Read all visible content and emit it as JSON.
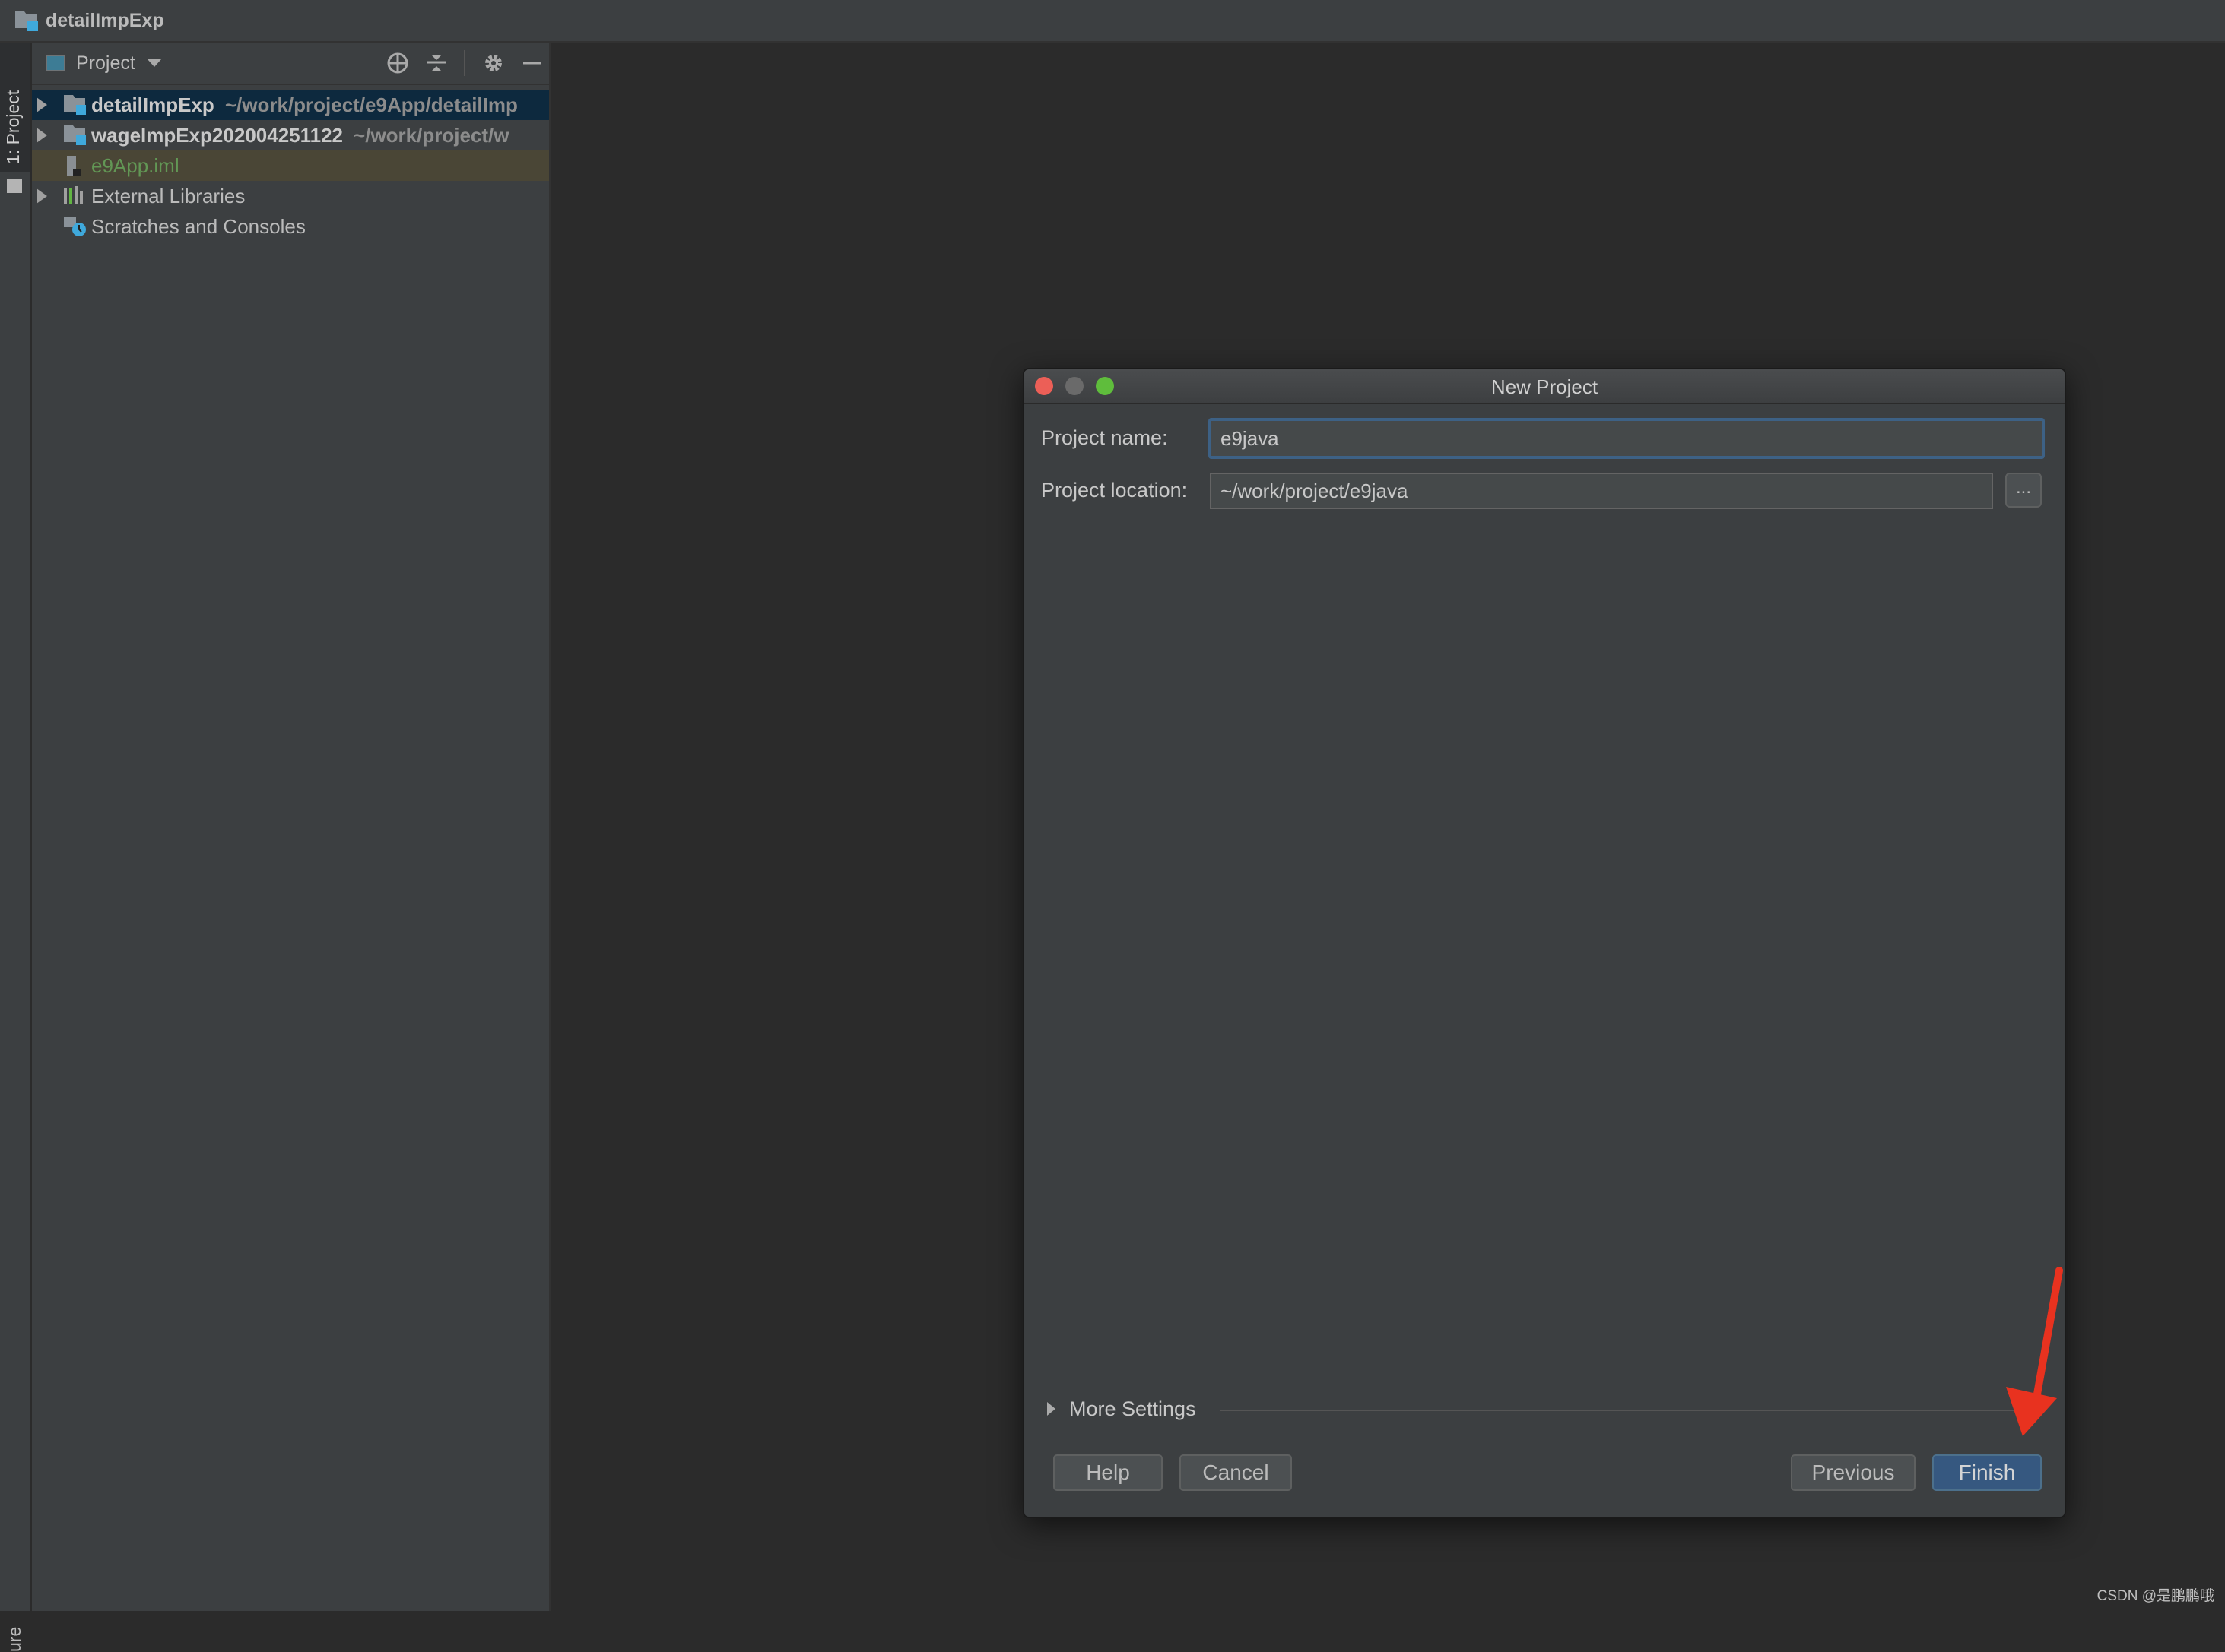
{
  "window": {
    "title": "detailImpExp"
  },
  "left_stripe": {
    "project_tab": "1: Project",
    "bottom_tab_partial": "ure"
  },
  "project_panel": {
    "view_selector": "Project",
    "tools": [
      "locate-icon",
      "collapse-all-icon",
      "settings-icon",
      "hide-icon"
    ],
    "tree": [
      {
        "name": "detailImpExp",
        "path": "~/work/project/e9App/detailImp",
        "type": "module-folder",
        "expandable": true,
        "selected": true
      },
      {
        "name": "wageImpExp202004251122",
        "path": "~/work/project/w",
        "type": "module-folder",
        "expandable": true
      },
      {
        "name": "e9App.iml",
        "path": "",
        "type": "iml-file",
        "expandable": false
      },
      {
        "name": "External Libraries",
        "path": "",
        "type": "libraries",
        "expandable": true
      },
      {
        "name": "Scratches and Consoles",
        "path": "",
        "type": "scratches",
        "expandable": false
      }
    ]
  },
  "dialog": {
    "title": "New Project",
    "project_name_label": "Project name:",
    "project_name_value": "e9java",
    "project_location_label": "Project location:",
    "project_location_value": "~/work/project/e9java",
    "browse_label": "...",
    "more_settings_label": "More Settings",
    "buttons": {
      "help": "Help",
      "cancel": "Cancel",
      "previous": "Previous",
      "finish": "Finish"
    }
  },
  "colors": {
    "accent": "#365880",
    "focus_border": "#3d6185",
    "annotation_arrow": "#e8321f",
    "iml_text": "#629755"
  },
  "watermark": "CSDN @是鹏鹏哦"
}
